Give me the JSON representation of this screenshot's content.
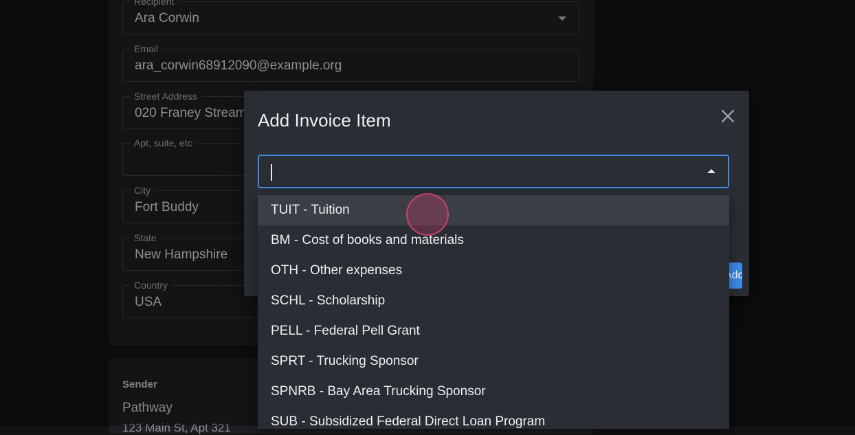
{
  "form": {
    "fields": [
      {
        "label": "Recipient",
        "value": "Ara Corwin"
      },
      {
        "label": "Email",
        "value": "ara_corwin68912090@example.org"
      },
      {
        "label": "Street Address",
        "value": "020 Franey Stream"
      },
      {
        "label": "Apt, suite, etc",
        "value": ""
      },
      {
        "label": "City",
        "value": "Fort Buddy"
      },
      {
        "label": "State",
        "value": "New Hampshire"
      },
      {
        "label": "Country",
        "value": "USA"
      }
    ],
    "sender": {
      "label": "Sender",
      "name": "Pathway",
      "address": "123 Main St, Apt 321"
    }
  },
  "dialog": {
    "title": "Add Invoice Item",
    "search_value": "",
    "submit_label": "Add Item",
    "options": [
      "TUIT - Tuition",
      "BM - Cost of books and materials",
      "OTH - Other expenses",
      "SCHL - Scholarship",
      "PELL - Federal Pell Grant",
      "SPRT - Trucking Sponsor",
      "SPNRB - Bay Area Trucking Sponsor",
      "SUB - Subsidized Federal Direct Loan Program"
    ]
  },
  "colors": {
    "accent": "#3d8ce9",
    "background": "#121315",
    "dialog": "#2a2d33"
  },
  "icons": {
    "close": "close-icon",
    "dropdown": "chevron-down-icon",
    "dropup": "chevron-up-icon"
  }
}
